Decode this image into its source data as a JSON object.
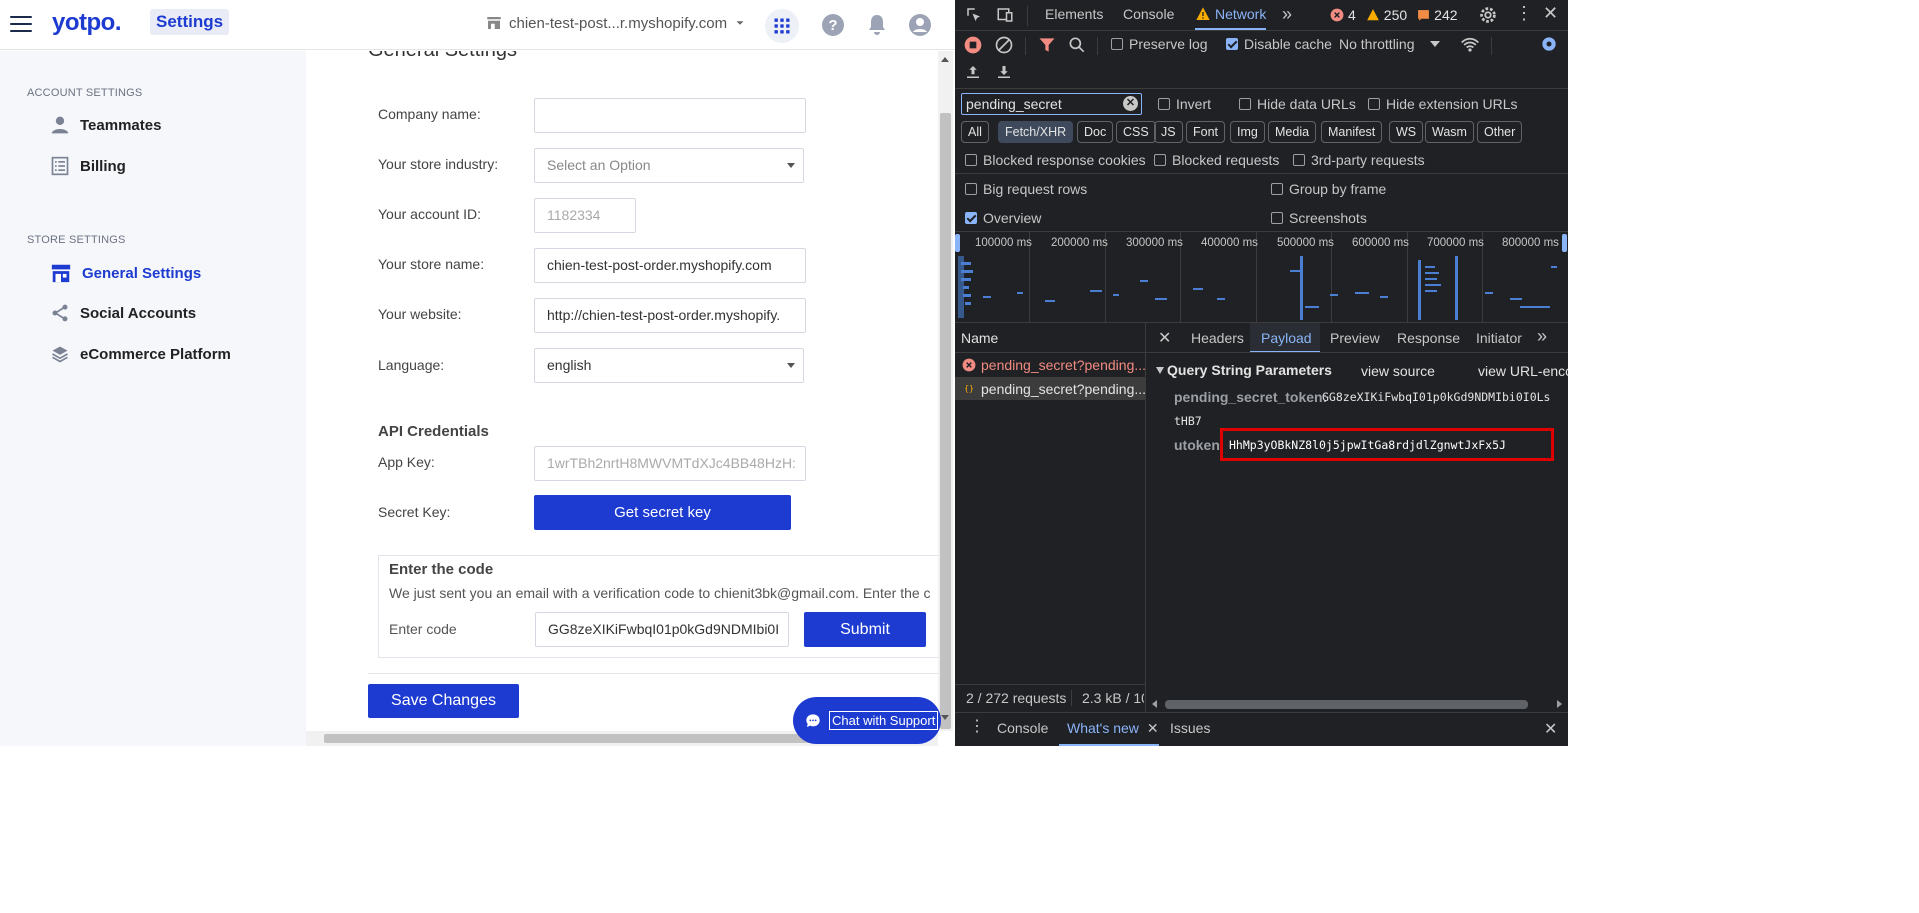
{
  "app": {
    "logo": "yotpo.",
    "section": "Settings",
    "store": "chien-test-post...r.myshopify.com"
  },
  "sidebar": {
    "account_title": "ACCOUNT SETTINGS",
    "store_title": "STORE SETTINGS",
    "items": [
      {
        "label": "Teammates",
        "icon": "person-icon"
      },
      {
        "label": "Billing",
        "icon": "list-icon"
      },
      {
        "label": "General Settings",
        "icon": "store-icon",
        "active": true
      },
      {
        "label": "Social Accounts",
        "icon": "share-icon"
      },
      {
        "label": "eCommerce Platform",
        "icon": "layers-icon"
      }
    ]
  },
  "form": {
    "heading": "General Settings",
    "company_label": "Company name:",
    "company_value": "",
    "industry_label": "Your store industry:",
    "industry_placeholder": "Select an Option",
    "account_label": "Your account ID:",
    "account_value": "1182334",
    "store_label": "Your store name:",
    "store_value": "chien-test-post-order.myshopify.com",
    "website_label": "Your website:",
    "website_value": "http://chien-test-post-order.myshopify.",
    "language_label": "Language:",
    "language_value": "english",
    "api_heading": "API Credentials",
    "appkey_label": "App Key:",
    "appkey_value": "1wrTBh2nrtH8MWVMTdXJc4BB48HzH:",
    "secret_label": "Secret Key:",
    "secret_button": "Get secret key",
    "code_heading": "Enter the code",
    "code_text": "We just sent you an email with a verification code to chienit3bk@gmail.com. Enter the c",
    "code_label": "Enter code",
    "code_value": "GG8zeXIKiFwbqI01p0kGd9NDMIbi0I",
    "submit": "Submit",
    "save": "Save Changes",
    "chat": "Chat with Support"
  },
  "devtools": {
    "tabs": [
      "Elements",
      "Console",
      "Network"
    ],
    "active_tab": "Network",
    "errors": "4",
    "warnings": "250",
    "issues": "242",
    "preserve_log": "Preserve log",
    "disable_cache": "Disable cache",
    "throttling": "No throttling",
    "filter_value": "pending_secret",
    "invert": "Invert",
    "hide_data": "Hide data URLs",
    "hide_ext": "Hide extension URLs",
    "types": [
      "All",
      "Fetch/XHR",
      "Doc",
      "CSS",
      "JS",
      "Font",
      "Img",
      "Media",
      "Manifest",
      "WS",
      "Wasm",
      "Other"
    ],
    "blocked_cookies": "Blocked response cookies",
    "blocked_requests": "Blocked requests",
    "third_party": "3rd-party requests",
    "big_rows": "Big request rows",
    "group_frame": "Group by frame",
    "overview": "Overview",
    "screenshots": "Screenshots",
    "ticks": [
      "100000 ms",
      "200000 ms",
      "300000 ms",
      "400000 ms",
      "500000 ms",
      "600000 ms",
      "700000 ms",
      "800000 ms"
    ],
    "name_header": "Name",
    "requests": [
      "pending_secret?pending...",
      "pending_secret?pending..."
    ],
    "sub_tabs": [
      "Headers",
      "Payload",
      "Preview",
      "Response",
      "Initiator"
    ],
    "active_sub": "Payload",
    "qsp_title": "Query String Parameters",
    "view_source": "view source",
    "view_url": "view URL-enco",
    "param1_key": "pending_secret_token:",
    "param1_val": "GG8zeXIKiFwbqI01p0kGd9NDMIbi0I0Ls",
    "param1_cont": "tHB7",
    "param2_key": "utoken",
    "param2_val": "HhMp3yOBkNZ8l0j5jpwItGa8rdjdlZgnwtJxFx5J",
    "status_requests": "2 / 272 requests",
    "status_size": "2.3 kB / 10",
    "drawer_tabs": [
      "Console",
      "What's new",
      "Issues"
    ],
    "active_drawer": "What's new"
  }
}
